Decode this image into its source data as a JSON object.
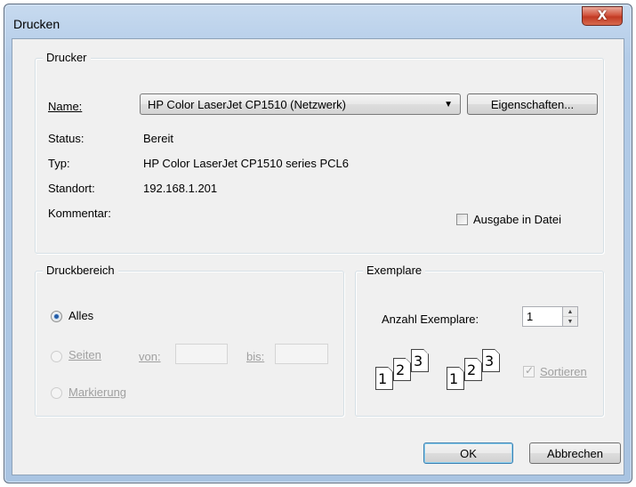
{
  "window": {
    "title": "Drucken",
    "close_symbol": "X"
  },
  "printer": {
    "legend": "Drucker",
    "name_label": "Name:",
    "name_value": "HP Color LaserJet CP1510 (Netzwerk)",
    "properties_label": "Eigenschaften...",
    "status_label": "Status:",
    "status_value": "Bereit",
    "type_label": "Typ:",
    "type_value": "HP Color LaserJet CP1510 series PCL6",
    "location_label": "Standort:",
    "location_value": "192.168.1.201",
    "comment_label": "Kommentar:",
    "print_to_file_label": "Ausgabe in Datei"
  },
  "range": {
    "legend": "Druckbereich",
    "all_label": "Alles",
    "pages_label": "Seiten",
    "from_label": "von:",
    "to_label": "bis:",
    "selection_label": "Markierung"
  },
  "copies": {
    "legend": "Exemplare",
    "count_label": "Anzahl Exemplare:",
    "count_value": "1",
    "collate_label": "Sortieren",
    "collate_pages": [
      "1",
      "2",
      "3"
    ]
  },
  "buttons": {
    "ok": "OK",
    "cancel": "Abbrechen"
  },
  "icons": {
    "dropdown": "chevron-down-icon",
    "spin_up": "up-arrow-icon",
    "spin_down": "down-arrow-icon"
  }
}
